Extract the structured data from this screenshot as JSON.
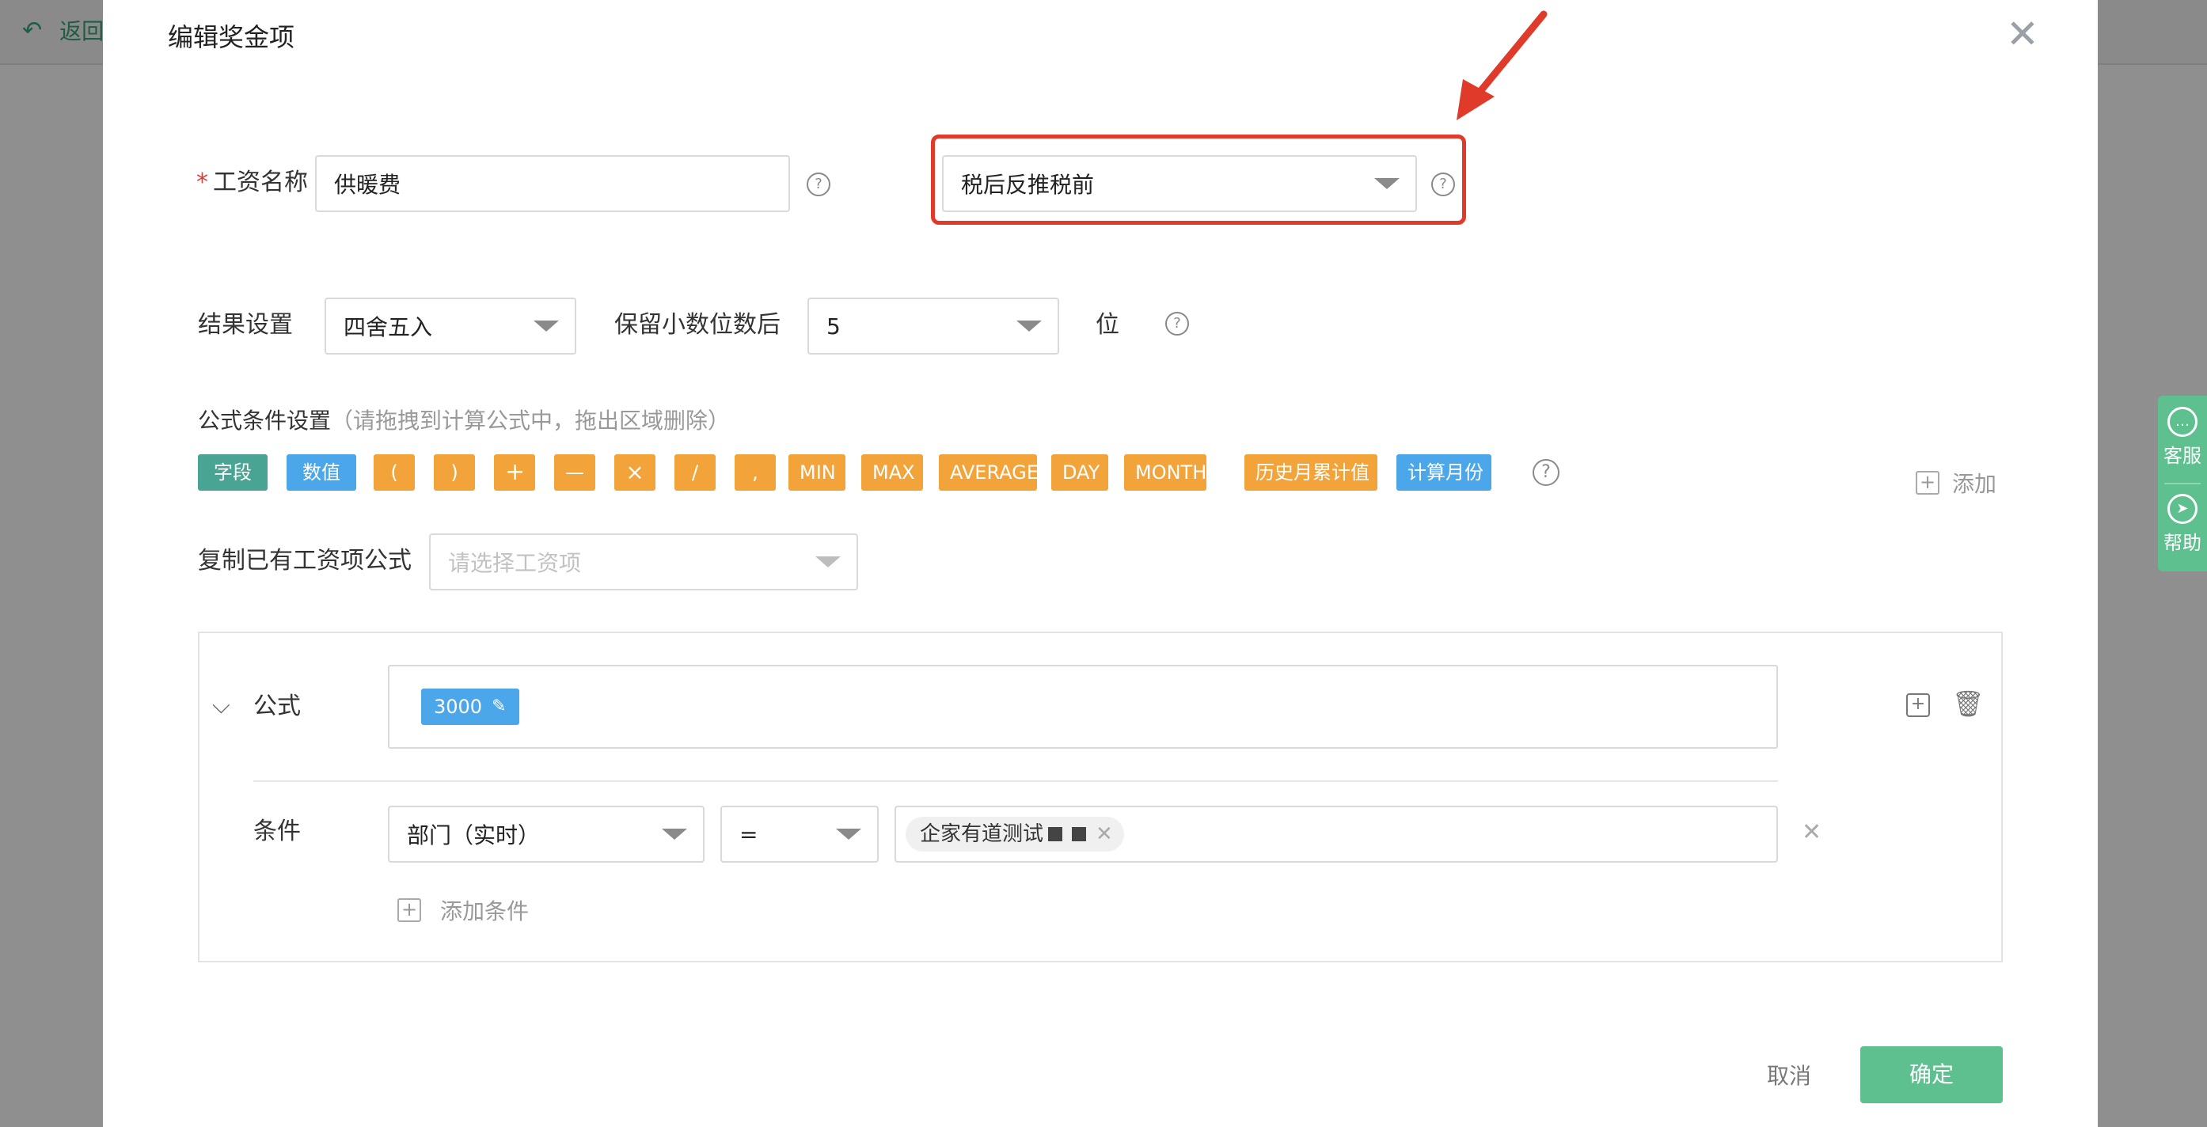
{
  "background": {
    "back_label": "返回"
  },
  "dialog": {
    "title": "编辑奖金项",
    "close_glyph": "✕",
    "salary_name": {
      "required_mark": "*",
      "label": "工资名称",
      "value": "供暖费"
    },
    "tax_mode": {
      "value": "税后反推税前"
    },
    "help_glyph": "?",
    "result": {
      "label": "结果设置",
      "rounding_value": "四舍五入",
      "decimal_label": "保留小数位数后",
      "decimal_value": "5",
      "unit": "位"
    },
    "formula_conditions": {
      "label": "公式条件设置",
      "hint": "（请拖拽到计算公式中，拖出区域删除）",
      "tokens": [
        "字段",
        "数值",
        "(",
        ")",
        "+",
        "—",
        "×",
        "/",
        ",",
        "MIN",
        "MAX",
        "AVERAGE",
        "DAY",
        "MONTH",
        "历史月累计值",
        "计算月份"
      ],
      "add_label": "添加"
    },
    "copy_formula": {
      "label": "复制已有工资项公式",
      "placeholder": "请选择工资项"
    },
    "formula_panel": {
      "formula_label": "公式",
      "formula_value": "3000",
      "condition_label": "条件",
      "condition_field": "部门（实时）",
      "condition_operator": "=",
      "condition_value": "企家有道测试",
      "add_condition_label": "添加条件"
    },
    "footer": {
      "cancel": "取消",
      "ok": "确定"
    }
  },
  "side_widget": {
    "service": "客服",
    "help": "帮助"
  },
  "colors": {
    "primary": "#5dc08e",
    "highlight": "#e03a2a",
    "tag_blue": "#4ba6ea",
    "tag_orange": "#f2a33a",
    "tag_green": "#4aa494"
  }
}
